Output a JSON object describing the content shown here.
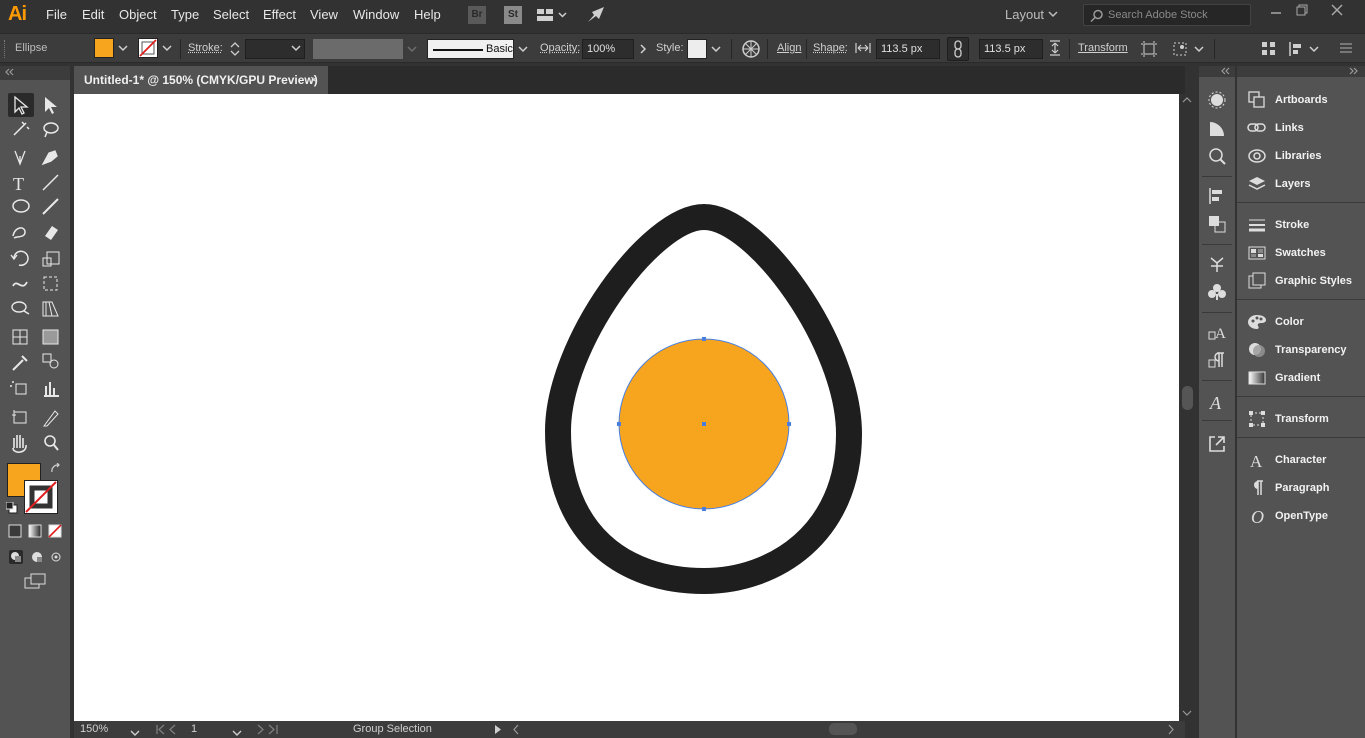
{
  "app": {
    "logo": "Ai"
  },
  "menu": [
    "File",
    "Edit",
    "Object",
    "Type",
    "Select",
    "Effect",
    "View",
    "Window",
    "Help"
  ],
  "menubar_icons": {
    "bridge": "Br",
    "stock": "St"
  },
  "workspace": "Layout",
  "search": {
    "placeholder": "Search Adobe Stock"
  },
  "control_bar": {
    "selection_label": "Ellipse",
    "fill_color": "#f7a51f",
    "stroke_label": "Stroke:",
    "brush_label": "Basic",
    "opacity_label": "Opacity:",
    "opacity_value": "100%",
    "style_label": "Style:",
    "align_label": "Align",
    "shape_label": "Shape:",
    "width_value": "113.5 px",
    "height_value": "113.5 px",
    "transform_label": "Transform"
  },
  "document": {
    "tab_title": "Untitled-1* @ 150% (CMYK/GPU Preview)",
    "close_glyph": "×"
  },
  "status_bar": {
    "zoom": "150%",
    "artboard_num": "1",
    "tool_status": "Group Selection"
  },
  "artwork": {
    "egg_stroke_color": "#1e1e1e",
    "egg_fill_color": "#ffffff",
    "yolk_color": "#f7a51f",
    "selection_color": "#4a7fe0"
  },
  "tools": {
    "fill_color": "#f7a51f",
    "items": [
      "selection-tool",
      "direct-selection-tool",
      "magic-wand-tool",
      "lasso-tool",
      "pen-tool",
      "curvature-tool",
      "type-tool",
      "line-segment-tool",
      "ellipse-tool",
      "paintbrush-tool",
      "shaper-tool",
      "eraser-tool",
      "rotate-tool",
      "scale-tool",
      "width-tool",
      "free-transform-tool",
      "shape-builder-tool",
      "perspective-grid-tool",
      "mesh-tool",
      "gradient-tool",
      "eyedropper-tool",
      "blend-tool",
      "symbol-sprayer-tool",
      "column-graph-tool",
      "artboard-tool",
      "slice-tool",
      "hand-tool",
      "zoom-tool"
    ]
  },
  "panels": [
    {
      "label": "Artboards",
      "icon": "artboards-icon"
    },
    {
      "label": "Links",
      "icon": "links-icon"
    },
    {
      "label": "Libraries",
      "icon": "libraries-icon"
    },
    {
      "label": "Layers",
      "icon": "layers-icon"
    },
    {
      "label": "Stroke",
      "icon": "stroke-icon"
    },
    {
      "label": "Swatches",
      "icon": "swatches-icon"
    },
    {
      "label": "Graphic Styles",
      "icon": "graphic-styles-icon"
    },
    {
      "label": "Color",
      "icon": "color-icon"
    },
    {
      "label": "Transparency",
      "icon": "transparency-icon"
    },
    {
      "label": "Gradient",
      "icon": "gradient-icon"
    },
    {
      "label": "Transform",
      "icon": "transform-icon"
    },
    {
      "label": "Character",
      "icon": "character-icon"
    },
    {
      "label": "Paragraph",
      "icon": "paragraph-icon"
    },
    {
      "label": "OpenType",
      "icon": "opentype-icon"
    }
  ]
}
